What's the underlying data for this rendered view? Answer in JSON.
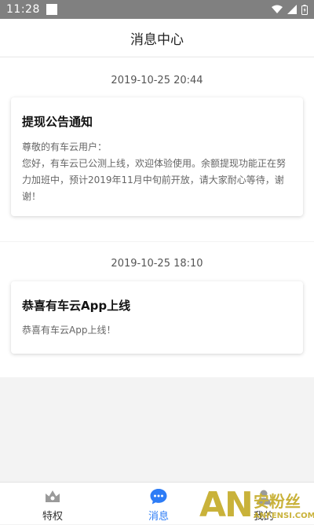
{
  "status_bar": {
    "time": "11:28"
  },
  "header": {
    "title": "消息中心"
  },
  "messages": [
    {
      "time": "2019-10-25 20:44",
      "title": "提现公告通知",
      "lines": [
        "尊敬的有车云用户：",
        "您好，有车云已公测上线，欢迎体验使用。余额提现功能正在努",
        "力加班中，预计2019年11月中旬前开放，请大家耐心等待，谢",
        "谢！"
      ]
    },
    {
      "time": "2019-10-25 18:10",
      "title": "恭喜有车云App上线",
      "lines": [
        "恭喜有车云App上线！"
      ]
    }
  ],
  "tabs": [
    {
      "label": "特权",
      "icon": "crown-icon",
      "active": false
    },
    {
      "label": "消息",
      "icon": "chat-icon",
      "active": true
    },
    {
      "label": "我的",
      "icon": "person-icon",
      "active": false
    }
  ],
  "watermark": {
    "brand": "AN",
    "cn": "安粉丝",
    "url": "ANFENSI.COM"
  },
  "colors": {
    "accent": "#2d7cf6",
    "status_bar": "#808080",
    "watermark": "#c9b23a"
  }
}
